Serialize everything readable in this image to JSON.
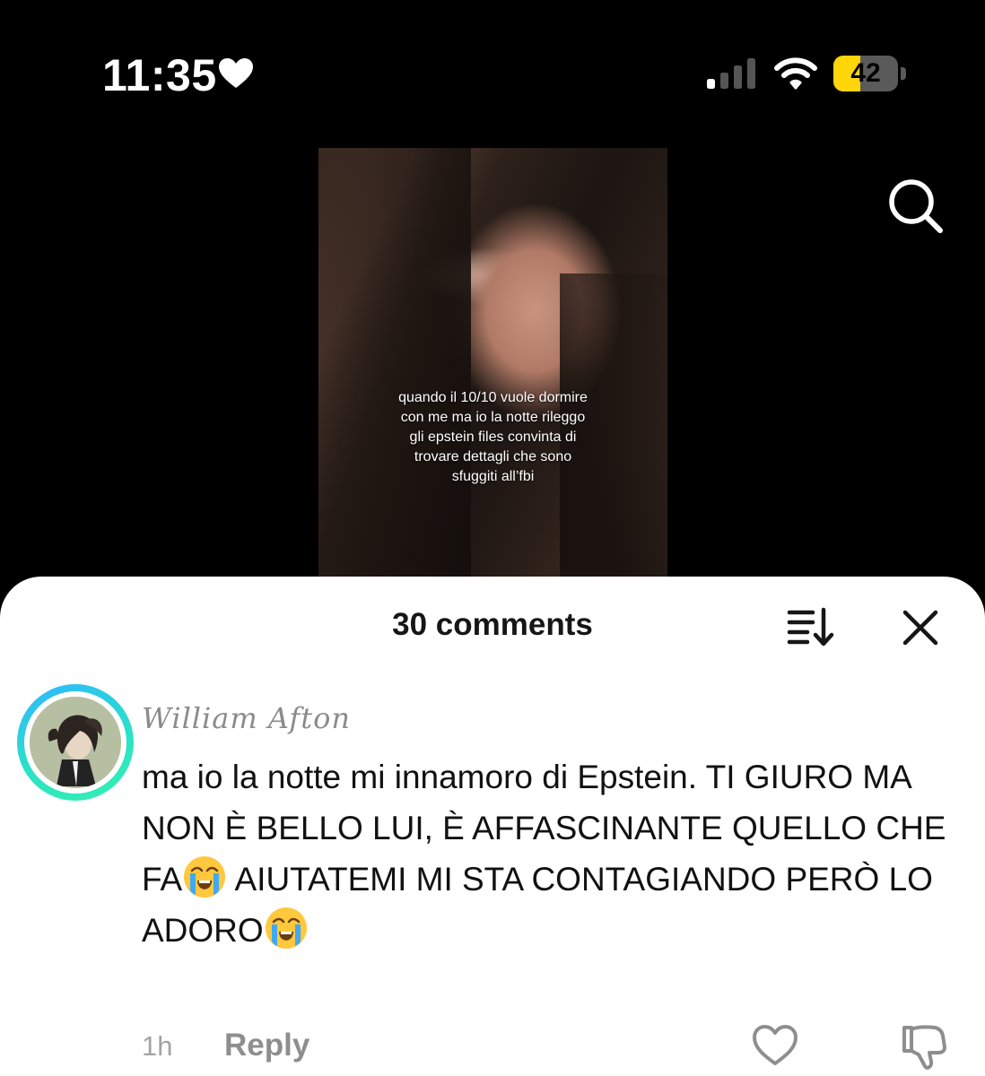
{
  "status_bar": {
    "time": "11:35",
    "battery_level": "42",
    "battery_fraction": 0.42,
    "icons": [
      "heart-icon",
      "signal-icon",
      "wifi-icon",
      "battery-icon"
    ]
  },
  "video": {
    "caption_lines": [
      "quando il 10/10 vuole dormire",
      "con me ma io la notte rileggo",
      "gli epstein files convinta di",
      "trovare dettagli che sono",
      "sfuggiti all’fbi"
    ]
  },
  "top_icons": [
    "search-icon"
  ],
  "comments_sheet": {
    "title": "30 comments",
    "header_icons": [
      "sort-icon",
      "close-icon"
    ]
  },
  "comment": {
    "username": "William Afton",
    "text_parts": [
      "ma io la notte mi innamoro di Epstein. TI GIURO MA NON È BELLO LUI, È AFFASCINANTE QUELLO CHE FA",
      "AIUTATEMI MI STA CONTAGIANDO PERÒ LO ADORO"
    ],
    "emoji": "loudly-crying-face-emoji",
    "time": "1h",
    "reply_label": "Reply",
    "action_icons": [
      "heart-outline-icon",
      "thumbs-down-icon"
    ]
  },
  "colors": {
    "sheet_background": "#ffffff",
    "battery_yellow": "#ffd60a",
    "avatar_ring": "#2be1c8",
    "secondary_text": "#8e8e8e"
  }
}
